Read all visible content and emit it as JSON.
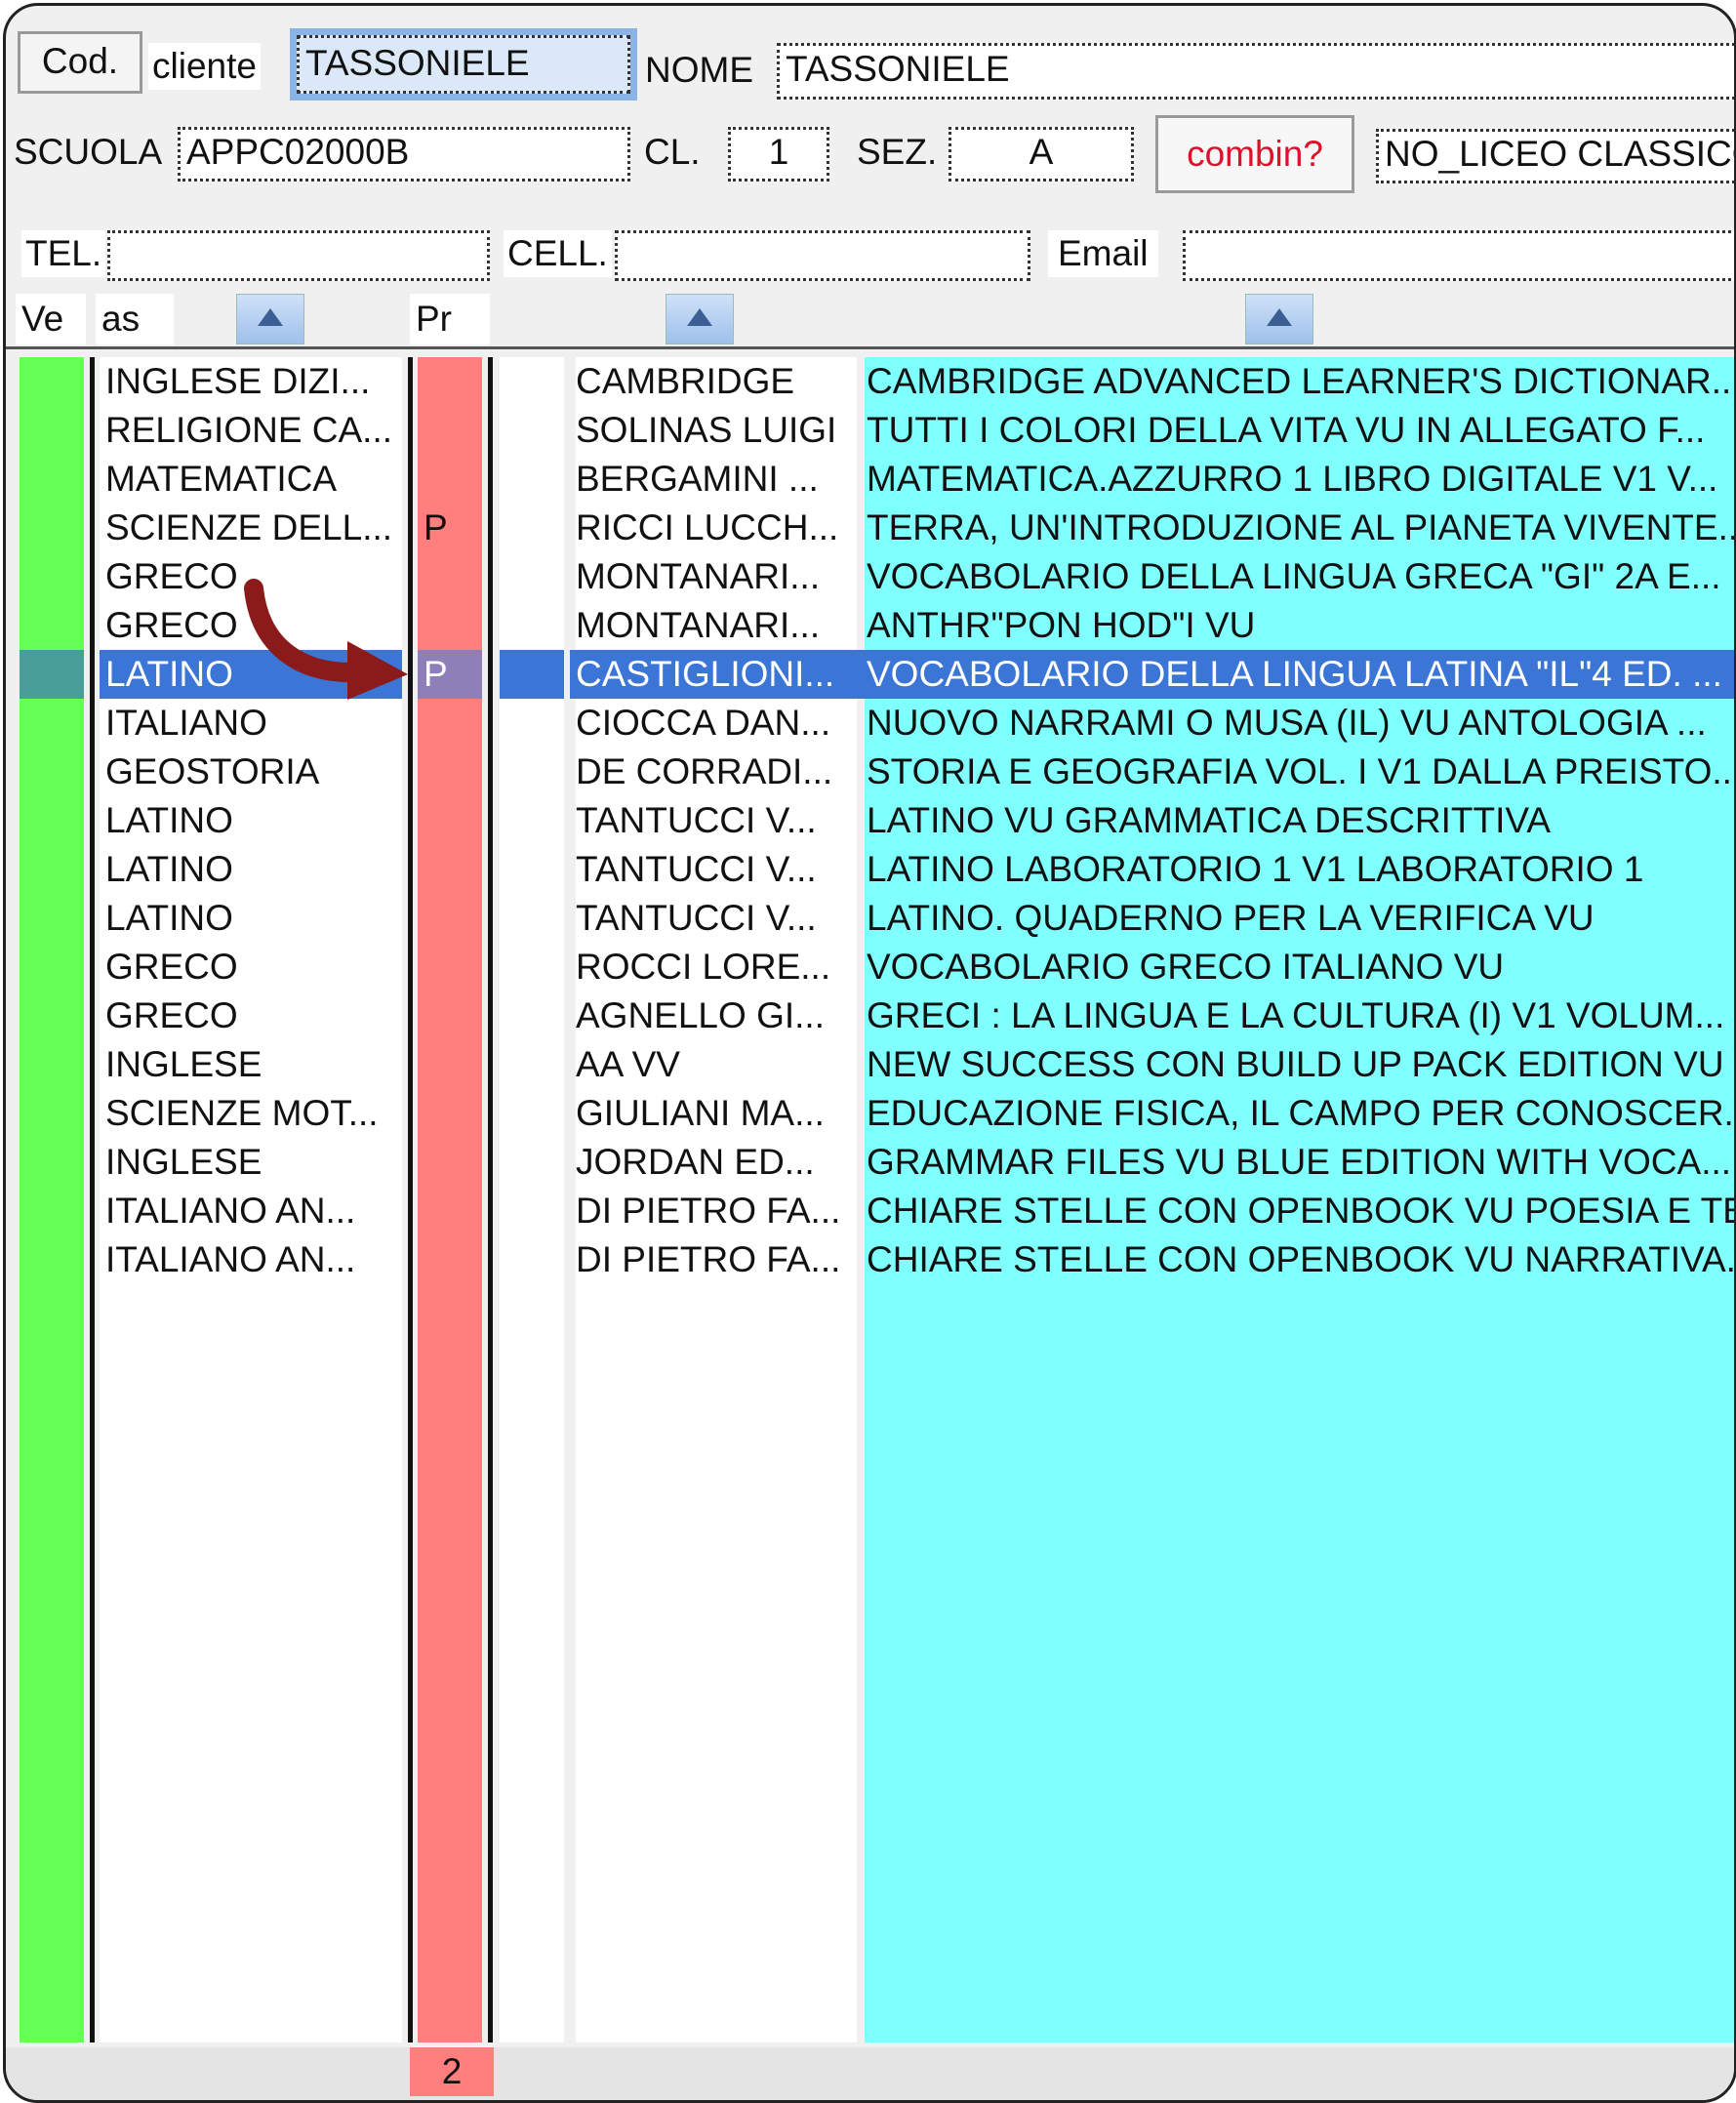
{
  "header": {
    "cod_button": "Cod.",
    "cliente_label": "cliente",
    "cliente_value": "TASSONIELE",
    "nome_label": "NOME",
    "nome_value": "TASSONIELE",
    "scuola_label": "SCUOLA",
    "scuola_value": "APPC02000B",
    "cl_label": "CL.",
    "cl_value": "1",
    "sez_label": "SEZ.",
    "sez_value": "A",
    "combin_button": "combin?",
    "tipo_value": "NO_LICEO CLASSICO",
    "tel_label": "TEL.",
    "tel_value": "",
    "cell_label": "CELL.",
    "cell_value": "",
    "email_label": "Email",
    "email_value": ""
  },
  "columns": {
    "ve": "Ve",
    "as": "as",
    "pr": "Pr"
  },
  "rows": [
    {
      "materia": "INGLESE DIZI...",
      "pr": "",
      "autore": "CAMBRIDGE",
      "titolo": "CAMBRIDGE ADVANCED LEARNER'S DICTIONAR..."
    },
    {
      "materia": "RELIGIONE CA...",
      "pr": "",
      "autore": "SOLINAS LUIGI",
      "titolo": "TUTTI I COLORI DELLA VITA VU IN ALLEGATO F..."
    },
    {
      "materia": "MATEMATICA",
      "pr": "",
      "autore": "BERGAMINI ...",
      "titolo": "MATEMATICA.AZZURRO 1 LIBRO DIGITALE V1 V..."
    },
    {
      "materia": "SCIENZE DELL...",
      "pr": "P",
      "autore": "RICCI LUCCH...",
      "titolo": "TERRA, UN'INTRODUZIONE AL PIANETA VIVENTE..."
    },
    {
      "materia": "GRECO",
      "pr": "",
      "autore": "MONTANARI...",
      "titolo": "VOCABOLARIO DELLA LINGUA GRECA \"GI\" 2A E..."
    },
    {
      "materia": "GRECO",
      "pr": "",
      "autore": "MONTANARI...",
      "titolo": "ANTHR\"PON HOD\"I VU"
    },
    {
      "materia": "LATINO",
      "pr": "P",
      "autore": "CASTIGLIONI...",
      "titolo": "VOCABOLARIO DELLA LINGUA LATINA \"IL\"4 ED. ..."
    },
    {
      "materia": "ITALIANO",
      "pr": "",
      "autore": "CIOCCA DAN...",
      "titolo": "NUOVO NARRAMI O MUSA (IL) VU ANTOLOGIA ..."
    },
    {
      "materia": "GEOSTORIA",
      "pr": "",
      "autore": "DE CORRADI...",
      "titolo": "STORIA E GEOGRAFIA VOL. I V1 DALLA PREISTO..."
    },
    {
      "materia": "LATINO",
      "pr": "",
      "autore": "TANTUCCI V...",
      "titolo": "LATINO VU GRAMMATICA DESCRITTIVA"
    },
    {
      "materia": "LATINO",
      "pr": "",
      "autore": "TANTUCCI V...",
      "titolo": "LATINO LABORATORIO 1 V1 LABORATORIO 1"
    },
    {
      "materia": "LATINO",
      "pr": "",
      "autore": "TANTUCCI V...",
      "titolo": "LATINO. QUADERNO PER LA VERIFICA VU"
    },
    {
      "materia": "GRECO",
      "pr": "",
      "autore": "ROCCI LORE...",
      "titolo": "VOCABOLARIO GRECO ITALIANO VU"
    },
    {
      "materia": "GRECO",
      "pr": "",
      "autore": "AGNELLO GI...",
      "titolo": "GRECI : LA LINGUA E LA CULTURA (I) V1 VOLUM..."
    },
    {
      "materia": "INGLESE",
      "pr": "",
      "autore": "AA VV",
      "titolo": "NEW SUCCESS CON BUILD UP PACK EDITION VU"
    },
    {
      "materia": "SCIENZE MOT...",
      "pr": "",
      "autore": "GIULIANI MA...",
      "titolo": "EDUCAZIONE FISICA, IL CAMPO PER CONOSCER..."
    },
    {
      "materia": "INGLESE",
      "pr": "",
      "autore": "JORDAN ED...",
      "titolo": "GRAMMAR FILES VU BLUE EDITION  WITH VOCA..."
    },
    {
      "materia": "ITALIANO AN...",
      "pr": "",
      "autore": "DI PIETRO FA...",
      "titolo": "CHIARE STELLE CON OPENBOOK VU POESIA E TE..."
    },
    {
      "materia": "ITALIANO AN...",
      "pr": "",
      "autore": "DI PIETRO FA...",
      "titolo": "CHIARE STELLE CON OPENBOOK VU NARRATIVA..."
    }
  ],
  "selected_row": 6,
  "footer": {
    "pr_total": "2"
  },
  "colors": {
    "ve_column": "#66ff55",
    "pr_column": "#ff7f7f",
    "titolo_column": "#80ffff",
    "selection": "#3b76d6",
    "arrow": "#8b1a1a",
    "combin_text": "#e0102a"
  },
  "icons": {
    "sort": "triangle-up-icon",
    "annotation": "curved-arrow-icon"
  }
}
